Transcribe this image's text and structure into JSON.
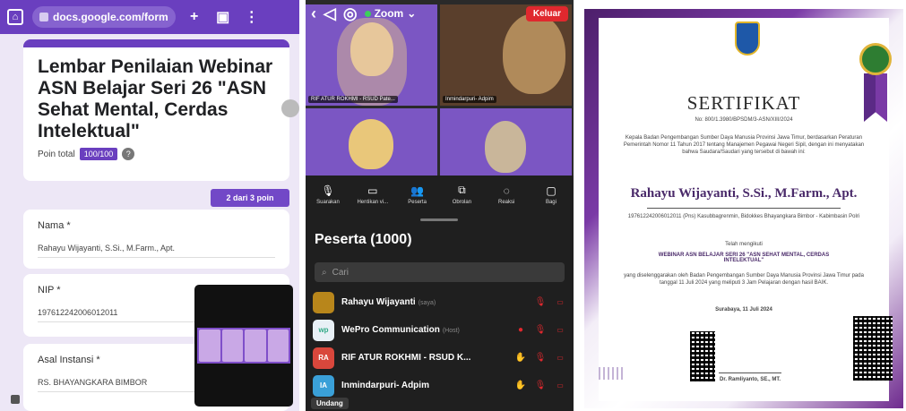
{
  "form": {
    "url": "docs.google.com/form",
    "title": "Lembar Penilaian Webinar ASN Belajar Seri 26 \"ASN Sehat Mental, Cerdas Intelektual\"",
    "poin_label": "Poin total",
    "poin_value": "100/100",
    "page_indicator": "2 dari 3 poin",
    "fields": [
      {
        "label": "Nama *",
        "value": "Rahayu Wijayanti, S.Si., M.Farm., Apt."
      },
      {
        "label": "NIP *",
        "value": "197612242006012011"
      },
      {
        "label": "Asal Instansi *",
        "value": "RS. BHAYANGKARA BIMBOR"
      }
    ]
  },
  "zoom": {
    "app_label": "Zoom",
    "leave_label": "Keluar",
    "tiles": [
      {
        "name": "RIF ATUR ROKHMI - RSUD Pate..."
      },
      {
        "name": "Inmindarpuri- Adpim"
      },
      {
        "name": ""
      },
      {
        "name": ""
      }
    ],
    "toolbar": [
      {
        "icon": "mic-icon",
        "label": "Suarakan"
      },
      {
        "icon": "video-icon",
        "label": "Hentikan vi..."
      },
      {
        "icon": "participants-icon",
        "label": "Peserta"
      },
      {
        "icon": "share-icon",
        "label": "Obrolan"
      },
      {
        "icon": "chat-icon",
        "label": "Reaksi"
      },
      {
        "icon": "more-icon",
        "label": "Bagi"
      }
    ],
    "participants_title": "Peserta (1000)",
    "search_placeholder": "Cari",
    "participants": [
      {
        "name": "Rahayu Wijayanti",
        "role": "(saya)",
        "avatar_text": "",
        "avatar_color": "#b8861b",
        "hand": false
      },
      {
        "name": "WePro Communication",
        "role": "(Host)",
        "avatar_text": "",
        "avatar_color": "#e8f0f6",
        "hand": false
      },
      {
        "name": "RIF ATUR ROKHMI - RSUD K...",
        "role": "",
        "avatar_text": "RA",
        "avatar_color": "#d9473c",
        "hand": true
      },
      {
        "name": "Inmindarpuri- Adpim",
        "role": "",
        "avatar_text": "IA",
        "avatar_color": "#3aa0d8",
        "hand": true
      }
    ],
    "invite_label": "Undang"
  },
  "certificate": {
    "heading": "SERTIFIKAT",
    "number": "No: 800/1.3980/BPSDM/3-ASN/XIII/2024",
    "intro": "Kepala Badan Pengembangan Sumber Daya Manusia Provinsi Jawa Timur, berdasarkan Peraturan Pemerintah Nomor 11 Tahun 2017 tentang Manajemen Pegawai Negeri Sipil, dengan ini menyatakan bahwa Saudara/Saudari yang tersebut di bawah ini:",
    "recipient": "Rahayu Wijayanti, S.Si., M.Farm., Apt.",
    "recipient_meta": "197612242006012011 (Pns) Kasubbagrenmin, Bidokkes Bhayangkara Bimbor - Kabimbasin Polri",
    "has_followed": "Telah mengikuti",
    "webinar_title": "WEBINAR ASN BELAJAR SERI 26 \"ASN SEHAT MENTAL, CERDAS INTELEKTUAL\"",
    "organizer": "yang diselenggarakan oleh Badan Pengembangan Sumber Daya Manusia Provinsi Jawa Timur pada tanggal 11 Juli 2024 yang meliputi 3 Jam Pelajaran dengan hasil BAIK.",
    "place_date": "Surabaya, 11 Juli 2024",
    "signer": "Dr. Ramliyanto, SE., MT."
  },
  "colors": {
    "form_accent": "#6a3fbf",
    "zoom_bg": "#1f1f1f",
    "zoom_leave": "#e0282e",
    "tile_bg": "#7b56c3",
    "cert_purple": "#7a3aa6"
  }
}
